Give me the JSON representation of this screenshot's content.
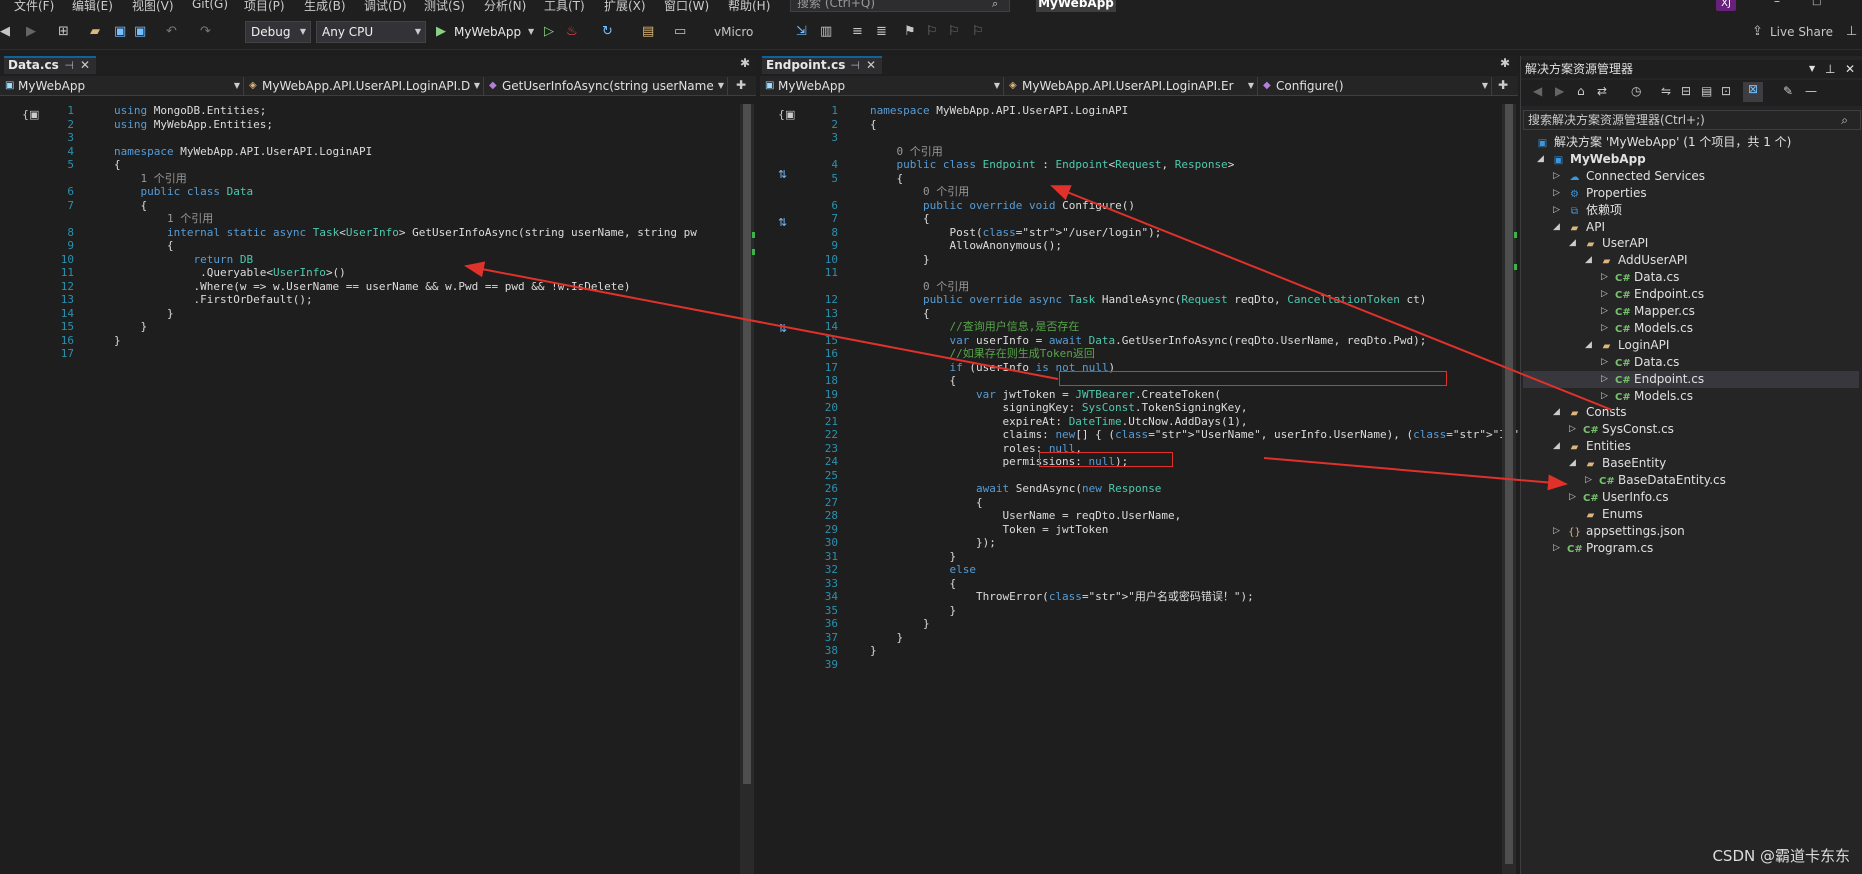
{
  "menu": {
    "items": [
      "文件(F)",
      "编辑(E)",
      "视图(V)",
      "Git(G)",
      "项目(P)",
      "生成(B)",
      "调试(D)",
      "测试(S)",
      "分析(N)",
      "工具(T)",
      "扩展(X)",
      "窗口(W)",
      "帮助(H)"
    ],
    "search_placeholder": "搜索 (Ctrl+Q)",
    "app_title": "MyWebApp",
    "user_initials": "XJ",
    "live_share": "Live Share"
  },
  "toolbar": {
    "config": "Debug",
    "platform": "Any CPU",
    "run_target": "MyWebApp",
    "vmicro": "vMicro"
  },
  "left_editor": {
    "tab": "Data.cs",
    "nav_project": "MyWebApp",
    "nav_class": "MyWebApp.API.UserAPI.LoginAPI.D",
    "nav_member": "GetUserInfoAsync(string userName",
    "line_numbers": [
      "1",
      "2",
      "3",
      "4",
      "5",
      "6",
      "7",
      "8",
      "9",
      "10",
      "11",
      "12",
      "13",
      "14",
      "15",
      "16",
      "17"
    ],
    "lines": [
      "using MongoDB.Entities;",
      "using MyWebApp.Entities;",
      "",
      "namespace MyWebApp.API.UserAPI.LoginAPI",
      "{",
      "    public class Data",
      "    {",
      "        internal static async Task<UserInfo> GetUserInfoAsync(string userName, string pw",
      "        {",
      "            return DB",
      "             .Queryable<UserInfo>()",
      "            .Where(w => w.UserName == userName && w.Pwd == pwd && !w.IsDelete)",
      "            .FirstOrDefault();",
      "        }",
      "    }",
      "}",
      ""
    ],
    "ref_hints": [
      "1 个引用",
      "1 个引用"
    ]
  },
  "right_editor": {
    "tab": "Endpoint.cs",
    "nav_project": "MyWebApp",
    "nav_class": "MyWebApp.API.UserAPI.LoginAPI.Er",
    "nav_member": "Configure()",
    "line_numbers": [
      "1",
      "2",
      "3",
      "4",
      "5",
      "6",
      "7",
      "8",
      "9",
      "10",
      "11",
      "12",
      "13",
      "14",
      "15",
      "16",
      "17",
      "18",
      "19",
      "20",
      "21",
      "22",
      "23",
      "24",
      "25",
      "26",
      "27",
      "28",
      "29",
      "30",
      "31",
      "32",
      "33",
      "34",
      "35",
      "36",
      "37",
      "38",
      "39"
    ],
    "lines": [
      "namespace MyWebApp.API.UserAPI.LoginAPI",
      "{",
      "",
      "    public class Endpoint : Endpoint<Request, Response>",
      "    {",
      "        public override void Configure()",
      "        {",
      "            Post(\"/user/login\");",
      "            AllowAnonymous();",
      "        }",
      "",
      "        public override async Task HandleAsync(Request reqDto, CancellationToken ct)",
      "        {",
      "            //查询用户信息,是否存在",
      "            var userInfo = await Data.GetUserInfoAsync(reqDto.UserName, reqDto.Pwd);",
      "            //如果存在则生成Token返回",
      "            if (userInfo is not null)",
      "            {",
      "                var jwtToken = JWTBearer.CreateToken(",
      "                    signingKey: SysConst.TokenSigningKey,",
      "                    expireAt: DateTime.UtcNow.AddDays(1),",
      "                    claims: new[] { (\"UserName\", userInfo.UserName), (\"ID\", userInfo.ID)",
      "                    roles: null,",
      "                    permissions: null);",
      "",
      "                await SendAsync(new Response",
      "                {",
      "                    UserName = reqDto.UserName,",
      "                    Token = jwtToken",
      "                });",
      "            }",
      "            else",
      "            {",
      "                ThrowError(\"用户名或密码错误！\");",
      "            }",
      "        }",
      "    }",
      "}",
      ""
    ],
    "ref_hints": [
      "0 个引用",
      "0 个引用",
      "0 个引用"
    ]
  },
  "solution_explorer": {
    "title": "解决方案资源管理器",
    "search_placeholder": "搜索解决方案资源管理器(Ctrl+;)",
    "items": [
      {
        "label": "解决方案 'MyWebApp' (1 个项目，共 1 个)",
        "kind": "solution"
      },
      {
        "label": "MyWebApp",
        "kind": "project"
      },
      {
        "label": "Connected Services",
        "kind": "service"
      },
      {
        "label": "Properties",
        "kind": "props"
      },
      {
        "label": "依赖项",
        "kind": "deps"
      },
      {
        "label": "API",
        "kind": "folder"
      },
      {
        "label": "UserAPI",
        "kind": "folder"
      },
      {
        "label": "AddUserAPI",
        "kind": "folder"
      },
      {
        "label": "Data.cs",
        "kind": "cs"
      },
      {
        "label": "Endpoint.cs",
        "kind": "cs"
      },
      {
        "label": "Mapper.cs",
        "kind": "cs"
      },
      {
        "label": "Models.cs",
        "kind": "cs"
      },
      {
        "label": "LoginAPI",
        "kind": "folder"
      },
      {
        "label": "Data.cs",
        "kind": "cs"
      },
      {
        "label": "Endpoint.cs",
        "kind": "cs"
      },
      {
        "label": "Models.cs",
        "kind": "cs"
      },
      {
        "label": "Consts",
        "kind": "folder"
      },
      {
        "label": "SysConst.cs",
        "kind": "cs"
      },
      {
        "label": "Entities",
        "kind": "folder"
      },
      {
        "label": "BaseEntity",
        "kind": "folder"
      },
      {
        "label": "BaseDataEntity.cs",
        "kind": "cs"
      },
      {
        "label": "UserInfo.cs",
        "kind": "cs"
      },
      {
        "label": "Enums",
        "kind": "folder"
      },
      {
        "label": "appsettings.json",
        "kind": "json"
      },
      {
        "label": "Program.cs",
        "kind": "cs"
      }
    ],
    "selected_index": 14
  },
  "watermark": "CSDN @霸道卡东东",
  "colors": {
    "accent": "#0e639c",
    "annotation": "#e0312b",
    "keyword": "#569cd6",
    "type": "#4ec9b0",
    "comment": "#57a64a"
  }
}
